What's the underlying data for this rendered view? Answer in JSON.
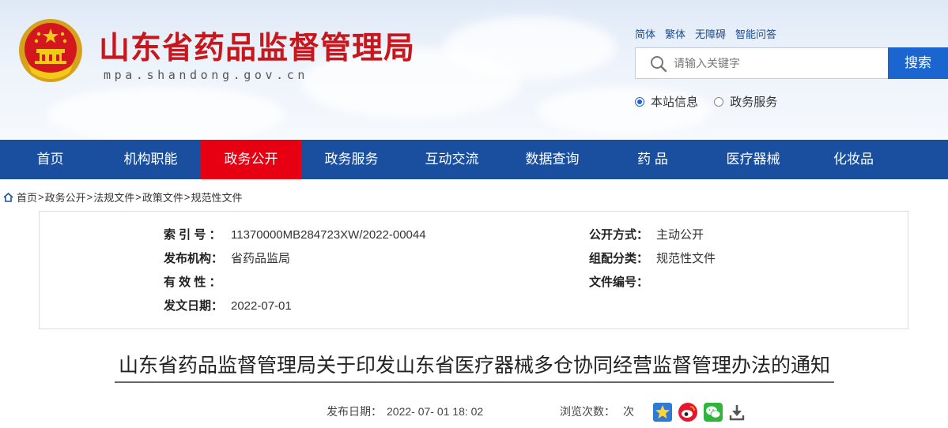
{
  "header": {
    "site_title": "山东省药品监督管理局",
    "site_domain": "mpa.shandong.gov.cn",
    "lang_links": [
      "简体",
      "繁体",
      "无障碍",
      "智能问答"
    ],
    "search": {
      "placeholder": "请输入关键字",
      "button_label": "搜索"
    },
    "scope_options": [
      {
        "label": "本站信息",
        "checked": true
      },
      {
        "label": "政务服务",
        "checked": false
      }
    ]
  },
  "nav": {
    "items": [
      "首页",
      "机构职能",
      "政务公开",
      "政务服务",
      "互动交流",
      "数据查询",
      "药 品",
      "医疗器械",
      "化妆品"
    ],
    "active": "政务公开"
  },
  "breadcrumb": [
    "首页",
    "政务公开",
    "法规文件",
    "政策文件",
    "规范性文件"
  ],
  "info": {
    "index_no": {
      "label": "索 引 号 ：",
      "value": "11370000MB284723XW/2022-00044"
    },
    "publisher": {
      "label": "发布机构：",
      "value": "省药品监局"
    },
    "validity": {
      "label": "有 效 性 ：",
      "value": ""
    },
    "issue_date": {
      "label": "发文日期：",
      "value": "2022-07-01"
    },
    "open_mode": {
      "label": "公开方式：",
      "value": "主动公开"
    },
    "category": {
      "label": "组配分类：",
      "value": "规范性文件"
    },
    "doc_no": {
      "label": "文件编号：",
      "value": ""
    }
  },
  "article": {
    "title": "山东省药品监督管理局关于印发山东省医疗器械多仓协同经营监督管理办法的通知",
    "publish_label": "发布日期：",
    "publish_value": "2022- 07- 01 18: 02",
    "views_label": "浏览次数：",
    "views_unit": "次"
  },
  "colors": {
    "brand_red": "#c8161d",
    "nav_blue": "#1a4fa0",
    "active_red": "#e60012",
    "search_blue": "#1a65cf"
  }
}
